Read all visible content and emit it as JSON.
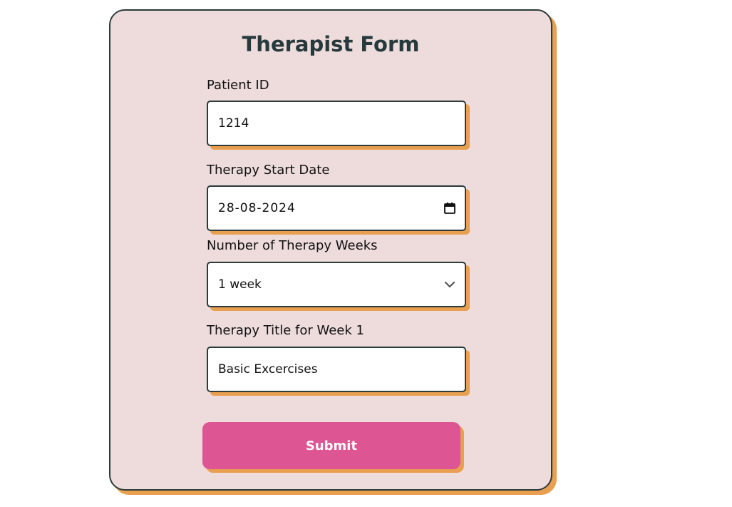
{
  "form": {
    "title": "Therapist Form",
    "patient_id": {
      "label": "Patient ID",
      "value": "1214"
    },
    "start_date": {
      "label": "Therapy Start Date",
      "value": "28-08-2024",
      "icon": "calendar-icon"
    },
    "weeks": {
      "label": "Number of Therapy Weeks",
      "value": "1 week",
      "icon": "chevron-down-icon"
    },
    "week_title": {
      "label": "Therapy Title for Week 1",
      "value": "Basic Excercises"
    },
    "submit_label": "Submit"
  },
  "colors": {
    "card_background": "#eedcdc",
    "border": "#2c3a3a",
    "shadow": "#e8a050",
    "title": "#26393d",
    "submit_background": "#de5594"
  }
}
